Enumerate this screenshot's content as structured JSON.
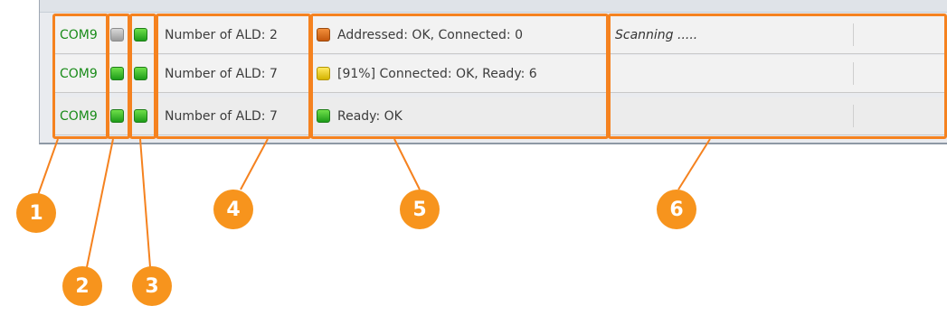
{
  "rows": [
    {
      "port": "COM9",
      "led2": "gray",
      "led3": "green",
      "ald": "Number of ALD: 2",
      "status_icon": "orange",
      "status": "Addressed: OK, Connected: 0",
      "info": "Scanning ....."
    },
    {
      "port": "COM9",
      "led2": "green",
      "led3": "green",
      "ald": "Number of ALD: 7",
      "status_icon": "yellow",
      "status": "[91%] Connected: OK, Ready: 6",
      "info": ""
    },
    {
      "port": "COM9",
      "led2": "green",
      "led3": "green",
      "ald": "Number of ALD: 7",
      "status_icon": "green",
      "status": "Ready: OK",
      "info": ""
    }
  ],
  "callouts": [
    "1",
    "2",
    "3",
    "4",
    "5",
    "6"
  ],
  "colors": {
    "highlight": "#f5821f",
    "badge": "#f7941d",
    "port_text": "#1a8c1a"
  }
}
